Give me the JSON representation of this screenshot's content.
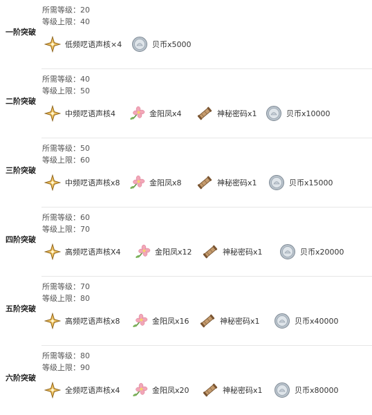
{
  "labels": {
    "required_level": "所需等级：",
    "level_cap": "等级上限："
  },
  "colors": {
    "star_gold": "#d9a441",
    "flower_pink": "#f2a6b8",
    "scroll_brown": "#a57c52",
    "coin_silver": "#b9c3cc",
    "divider": "#e6e6e6"
  },
  "tiers": [
    {
      "name": "一阶突破",
      "required_level": "20",
      "level_cap": "40",
      "items": [
        {
          "icon": "star-icon",
          "label": "低频呓语声核×4"
        },
        {
          "icon": "shell-coin-icon",
          "label": "贝币x5000"
        }
      ]
    },
    {
      "name": "二阶突破",
      "required_level": "40",
      "level_cap": "50",
      "items": [
        {
          "icon": "star-icon",
          "label": "中频呓语声核4"
        },
        {
          "icon": "flower-icon",
          "label": "金阳凤x4"
        },
        {
          "icon": "scroll-icon",
          "label": "神秘密码x1"
        },
        {
          "icon": "shell-coin-icon",
          "label": "贝币x10000"
        }
      ]
    },
    {
      "name": "三阶突破",
      "required_level": "50",
      "level_cap": "60",
      "items": [
        {
          "icon": "star-icon",
          "label": "中频呓语声核x8"
        },
        {
          "icon": "flower-icon",
          "label": "金阳凤x8"
        },
        {
          "icon": "scroll-icon",
          "label": "神秘密码x1"
        },
        {
          "icon": "shell-coin-icon",
          "label": "贝币x15000"
        }
      ]
    },
    {
      "name": "四阶突破",
      "required_level": "60",
      "level_cap": "70",
      "items": [
        {
          "icon": "star-icon",
          "label": "高频呓语声核X4"
        },
        {
          "icon": "flower-icon",
          "label": "金阳凤x12"
        },
        {
          "icon": "scroll-icon",
          "label": "神秘密码x1"
        },
        {
          "icon": "shell-coin-icon",
          "label": "贝币x20000"
        }
      ]
    },
    {
      "name": "五阶突破",
      "required_level": "70",
      "level_cap": "80",
      "items": [
        {
          "icon": "star-icon",
          "label": "高频呓语声核x8"
        },
        {
          "icon": "flower-icon",
          "label": "金阳凤x16"
        },
        {
          "icon": "scroll-icon",
          "label": "神秘密码x1"
        },
        {
          "icon": "shell-coin-icon",
          "label": "贝币x40000"
        }
      ]
    },
    {
      "name": "六阶突破",
      "required_level": "80",
      "level_cap": "90",
      "items": [
        {
          "icon": "star-icon",
          "label": "全频呓语声核x4"
        },
        {
          "icon": "flower-icon",
          "label": "金阳凤x20"
        },
        {
          "icon": "scroll-icon",
          "label": "神秘密码x1"
        },
        {
          "icon": "shell-coin-icon",
          "label": "贝币x80000"
        }
      ]
    }
  ]
}
